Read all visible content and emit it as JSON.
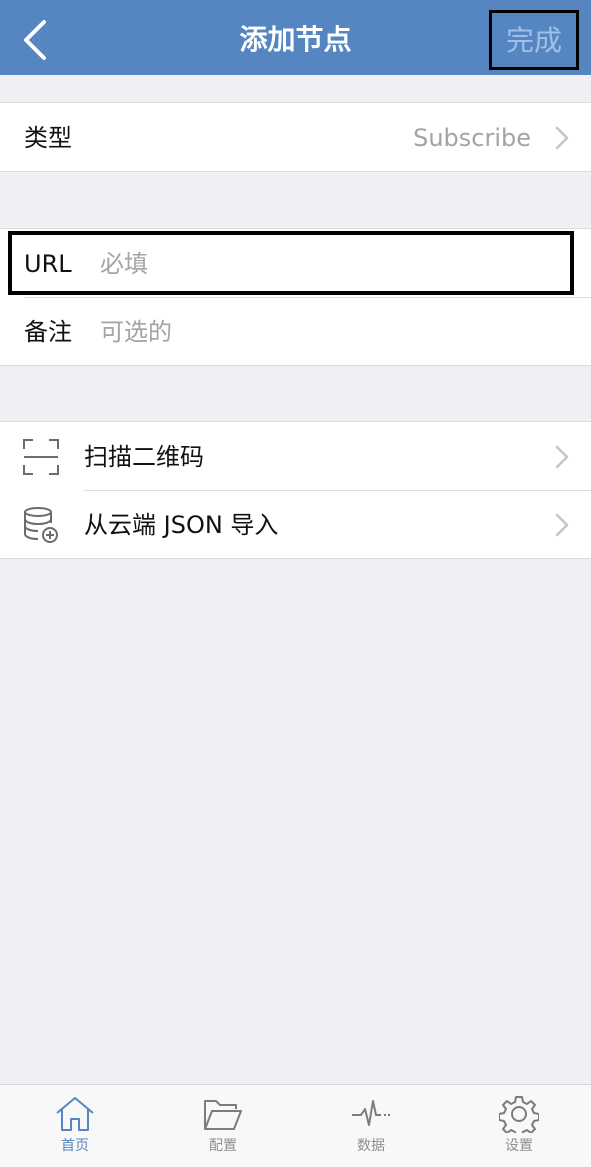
{
  "nav": {
    "title": "添加节点",
    "done_label": "完成"
  },
  "type_row": {
    "label": "类型",
    "value": "Subscribe"
  },
  "url_row": {
    "label": "URL",
    "placeholder": "必填"
  },
  "note_row": {
    "label": "备注",
    "placeholder": "可选的"
  },
  "actions": [
    {
      "label": "扫描二维码",
      "icon": "qr-scan-icon"
    },
    {
      "label": "从云端 JSON 导入",
      "icon": "database-import-icon"
    }
  ],
  "tabbar": {
    "items": [
      {
        "label": "首页",
        "icon": "home-icon",
        "active": true
      },
      {
        "label": "配置",
        "icon": "folder-icon",
        "active": false
      },
      {
        "label": "数据",
        "icon": "pulse-icon",
        "active": false
      },
      {
        "label": "设置",
        "icon": "gear-icon",
        "active": false
      }
    ]
  },
  "colors": {
    "nav_bg": "#5686c2",
    "page_bg": "#efeff4",
    "accent": "#5686c2"
  }
}
